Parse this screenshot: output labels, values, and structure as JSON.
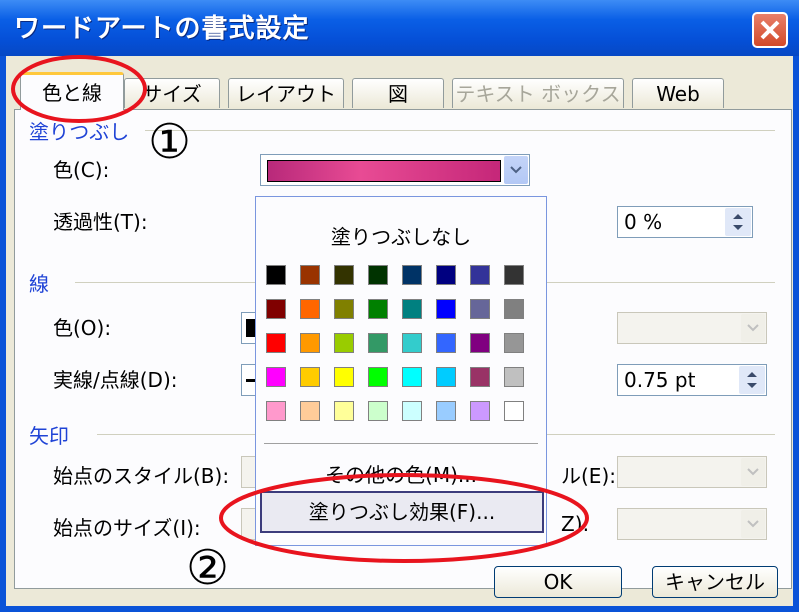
{
  "window": {
    "title": "ワードアートの書式設定"
  },
  "tabs": [
    {
      "label": "色と線"
    },
    {
      "label": "サイズ"
    },
    {
      "label": "レイアウト"
    },
    {
      "label": "図"
    },
    {
      "label": "テキスト ボックス"
    },
    {
      "label": "Web"
    }
  ],
  "fill": {
    "section": "塗りつぶし",
    "color_label": "色(C):",
    "transparency_label": "透過性(T):",
    "transparency_value": "0 %",
    "color_accent": "#e84b94"
  },
  "line": {
    "section": "線",
    "color_label": "色(O):",
    "dash_label": "実線/点線(D):",
    "weight_value": "0.75 pt"
  },
  "arrow": {
    "section": "矢印",
    "begin_style_label": "始点のスタイル(B):",
    "begin_size_label": "始点のサイズ(I):",
    "end_style_label_partial": "ル(E):",
    "end_size_label_partial": "Z):"
  },
  "popup": {
    "no_fill": "塗りつぶしなし",
    "more_colors": "その他の色(M)...",
    "fill_effects": "塗りつぶし効果(F)...",
    "palette": [
      [
        "#000000",
        "#993300",
        "#333300",
        "#003300",
        "#003366",
        "#000080",
        "#333399",
        "#333333"
      ],
      [
        "#800000",
        "#ff6600",
        "#808000",
        "#008000",
        "#008080",
        "#0000ff",
        "#666699",
        "#808080"
      ],
      [
        "#ff0000",
        "#ff9900",
        "#99cc00",
        "#339966",
        "#33cccc",
        "#3366ff",
        "#800080",
        "#969696"
      ],
      [
        "#ff00ff",
        "#ffcc00",
        "#ffff00",
        "#00ff00",
        "#00ffff",
        "#00ccff",
        "#993366",
        "#c0c0c0"
      ],
      [
        "#ff99cc",
        "#ffcc99",
        "#ffff99",
        "#ccffcc",
        "#ccffff",
        "#99ccff",
        "#cc99ff",
        "#ffffff"
      ]
    ]
  },
  "buttons": {
    "ok": "OK",
    "cancel": "キャンセル"
  },
  "annotations": {
    "one": "①",
    "two": "②"
  }
}
